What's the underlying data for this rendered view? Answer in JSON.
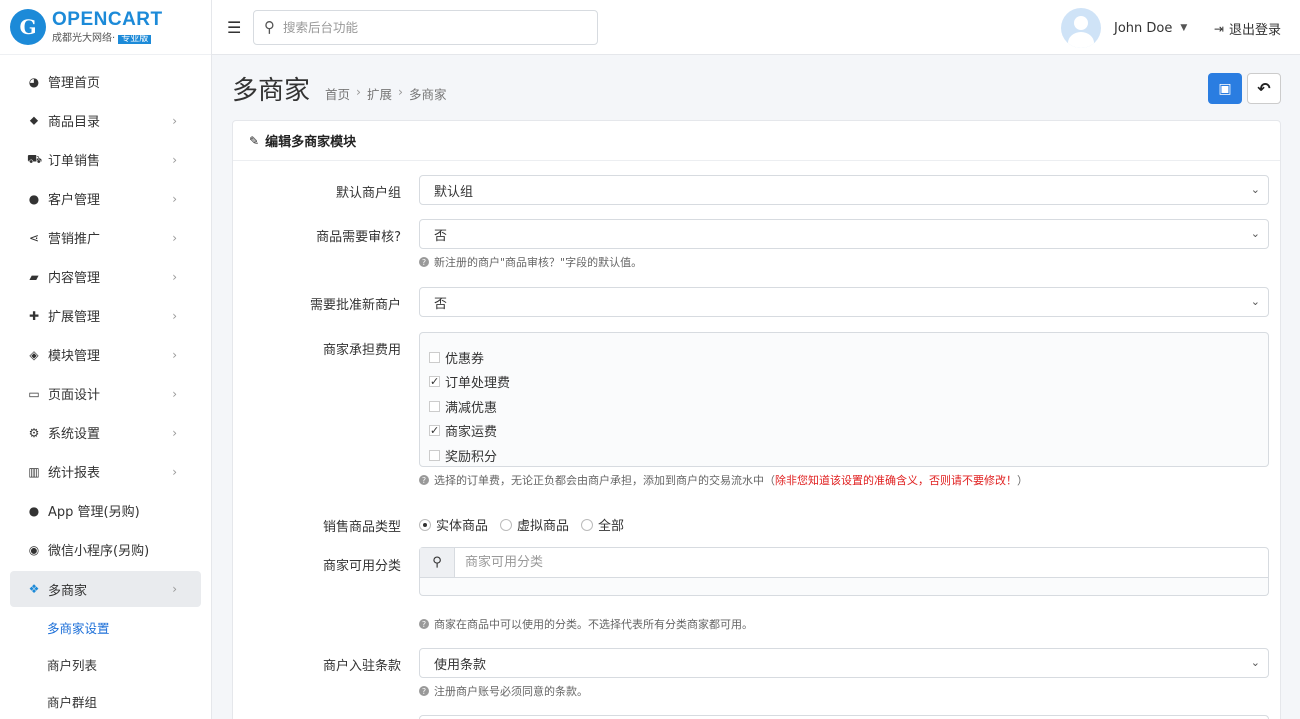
{
  "brand": {
    "logo_letter": "G",
    "name": "OPENCART",
    "sub": "成都光大网络·",
    "badge": "专业版"
  },
  "sidebar": {
    "items": [
      {
        "label": "管理首页",
        "icon": "dashboard-icon",
        "glyph": "◕",
        "chevron": ""
      },
      {
        "label": "商品目录",
        "icon": "tags-icon",
        "glyph": "⬥",
        "chevron": "›"
      },
      {
        "label": "订单销售",
        "icon": "cart-icon",
        "glyph": "⛟",
        "chevron": "›"
      },
      {
        "label": "客户管理",
        "icon": "user-icon",
        "glyph": "●",
        "chevron": "›"
      },
      {
        "label": "营销推广",
        "icon": "share-icon",
        "glyph": "⋖",
        "chevron": "›"
      },
      {
        "label": "内容管理",
        "icon": "book-icon",
        "glyph": "▰",
        "chevron": "›"
      },
      {
        "label": "扩展管理",
        "icon": "puzzle-icon",
        "glyph": "✚",
        "chevron": "›"
      },
      {
        "label": "模块管理",
        "icon": "cube-icon",
        "glyph": "◈",
        "chevron": "›"
      },
      {
        "label": "页面设计",
        "icon": "monitor-icon",
        "glyph": "▭",
        "chevron": "›"
      },
      {
        "label": "系统设置",
        "icon": "gear-icon",
        "glyph": "⚙",
        "chevron": "›"
      },
      {
        "label": "统计报表",
        "icon": "bar-chart-icon",
        "glyph": "▥",
        "chevron": "›"
      },
      {
        "label": "App 管理(另购)",
        "icon": "apple-icon",
        "glyph": "●",
        "chevron": ""
      },
      {
        "label": "微信小程序(另购)",
        "icon": "wechat-icon",
        "glyph": "◉",
        "chevron": ""
      },
      {
        "label": "多商家",
        "icon": "dropbox-icon",
        "glyph": "❖",
        "chevron": "›"
      }
    ],
    "sub_items": [
      "多商家设置",
      "商户列表",
      "商户群组"
    ]
  },
  "header": {
    "search_placeholder": "搜索后台功能",
    "user_name": "John Doe",
    "logout": "退出登录"
  },
  "page": {
    "title": "多商家",
    "breadcrumb": [
      "首页",
      "扩展",
      "多商家"
    ]
  },
  "card": {
    "title": "编辑多商家模块",
    "fields": {
      "default_group": {
        "label": "默认商户组",
        "value": "默认组"
      },
      "product_review": {
        "label": "商品需要审核?",
        "value": "否",
        "help": "新注册的商户\"商品审核？\"字段的默认值。"
      },
      "approve_new": {
        "label": "需要批准新商户",
        "value": "否"
      },
      "costs": {
        "label": "商家承担费用",
        "options": [
          {
            "label": "优惠券",
            "checked": false
          },
          {
            "label": "订单处理费",
            "checked": true
          },
          {
            "label": "满减优惠",
            "checked": false
          },
          {
            "label": "商家运费",
            "checked": true
          },
          {
            "label": "奖励积分",
            "checked": false
          }
        ],
        "help": "选择的订单费，无论正负都会由商户承担，添加到商户的交易流水中（",
        "help_warn": "除非您知道该设置的准确含义，否则请不要修改！",
        "help_end": "）"
      },
      "product_type": {
        "label": "销售商品类型",
        "options": [
          {
            "label": "实体商品",
            "checked": true
          },
          {
            "label": "虚拟商品",
            "checked": false
          },
          {
            "label": "全部",
            "checked": false
          }
        ]
      },
      "categories": {
        "label": "商家可用分类",
        "placeholder": "商家可用分类",
        "help": "商家在商品中可以使用的分类。不选择代表所有分类商家都可用。"
      },
      "terms": {
        "label": "商户入驻条款",
        "value": "使用条款",
        "help": "注册商户账号必须同意的条款。"
      }
    }
  }
}
